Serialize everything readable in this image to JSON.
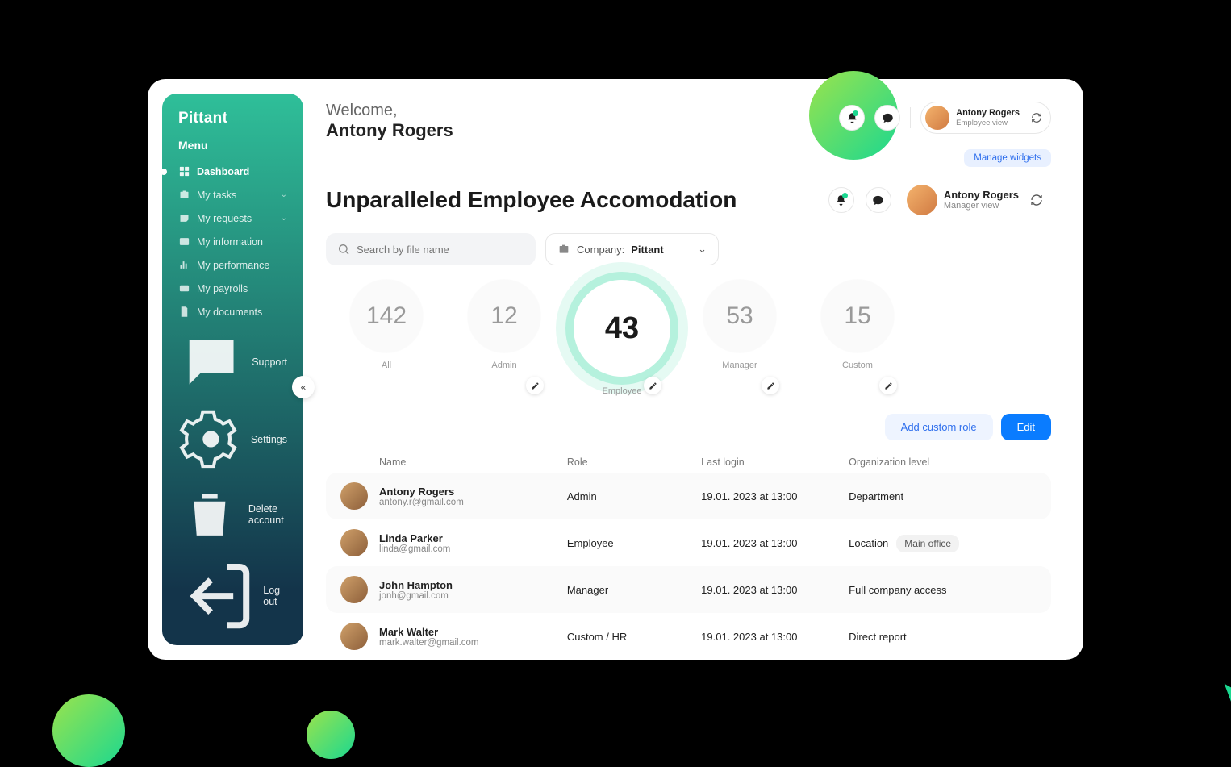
{
  "brand": "Pittant",
  "menu_label": "Menu",
  "nav": [
    {
      "label": "Dashboard",
      "active": true
    },
    {
      "label": "My tasks",
      "expandable": true
    },
    {
      "label": "My requests",
      "expandable": true
    },
    {
      "label": "My information"
    },
    {
      "label": "My performance"
    },
    {
      "label": "My payrolls"
    },
    {
      "label": "My documents"
    }
  ],
  "side_bottom": [
    {
      "label": "Support"
    },
    {
      "label": "Settings"
    },
    {
      "label": "Delete account"
    },
    {
      "label": "Log out"
    }
  ],
  "welcome": {
    "greet": "Welcome,",
    "name": "Antony Rogers"
  },
  "profile1": {
    "name": "Antony Rogers",
    "role": "Employee view"
  },
  "manage_widgets": "Manage widgets",
  "page_title": "Unparalleled Employee Accomodation",
  "profile2": {
    "name": "Antony Rogers",
    "role": "Manager view"
  },
  "search": {
    "placeholder": "Search by file name"
  },
  "filter": {
    "label": "Company:",
    "value": "Pittant"
  },
  "stats": [
    {
      "num": "142",
      "label": "All",
      "editable": false
    },
    {
      "num": "12",
      "label": "Admin",
      "editable": true
    },
    {
      "num": "43",
      "label": "Employee",
      "editable": true,
      "active": true
    },
    {
      "num": "53",
      "label": "Manager",
      "editable": true
    },
    {
      "num": "15",
      "label": "Custom",
      "editable": true
    }
  ],
  "actions": {
    "add": "Add custom role",
    "edit": "Edit"
  },
  "columns": {
    "c1": "Name",
    "c2": "Role",
    "c3": "Last login",
    "c4": "Organization level"
  },
  "rows": [
    {
      "name": "Antony Rogers",
      "email": "antony.r@gmail.com",
      "role": "Admin",
      "login": "19.01. 2023 at 13:00",
      "org": "Department",
      "alt": true
    },
    {
      "name": "Linda Parker",
      "email": "linda@gmail.com",
      "role": "Employee",
      "login": "19.01. 2023 at 13:00",
      "org": "Location",
      "tag": "Main office"
    },
    {
      "name": "John Hampton",
      "email": "jonh@gmail.com",
      "role": "Manager",
      "login": "19.01. 2023 at 13:00",
      "org": "Full company access",
      "alt": true
    },
    {
      "name": "Mark Walter",
      "email": "mark.walter@gmail.com",
      "role": "Custom / HR",
      "login": "19.01. 2023 at 13:00",
      "org": "Direct report"
    }
  ]
}
